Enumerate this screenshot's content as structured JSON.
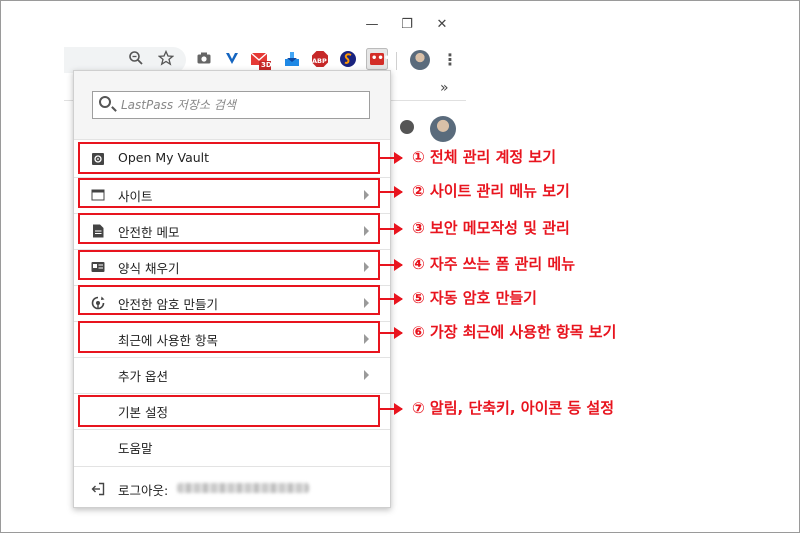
{
  "window": {
    "minimize": "—",
    "restore": "❐",
    "close": "✕"
  },
  "toolbar": {
    "mail_badge": "3D",
    "abp_label": "ABP",
    "lastpass_label": "•••",
    "more": "⋮",
    "bookmarks_overflow": "»"
  },
  "search": {
    "placeholder": "LastPass 저장소 검색"
  },
  "menu": {
    "items": [
      {
        "label": "Open My Vault"
      },
      {
        "label": "사이트"
      },
      {
        "label": "안전한 메모"
      },
      {
        "label": "양식 채우기"
      },
      {
        "label": "안전한 암호 만들기"
      },
      {
        "label": "최근에 사용한 항목"
      },
      {
        "label": "추가 옵션"
      },
      {
        "label": "기본 설정"
      },
      {
        "label": "도움말"
      }
    ],
    "logout_label": "로그아웃:"
  },
  "annotations": [
    "① 전체 관리 계정 보기",
    "② 사이트 관리 메뉴 보기",
    "③ 보안 메모작성 및 관리",
    "④ 자주 쓰는 폼 관리 메뉴",
    "⑤ 자동 암호 만들기",
    "⑥ 가장 최근에 사용한 항목 보기",
    "⑦ 알림, 단축키, 아이콘 등 설정"
  ],
  "colors": {
    "annotation": "#e8141e",
    "lastpass": "#d32d27"
  }
}
